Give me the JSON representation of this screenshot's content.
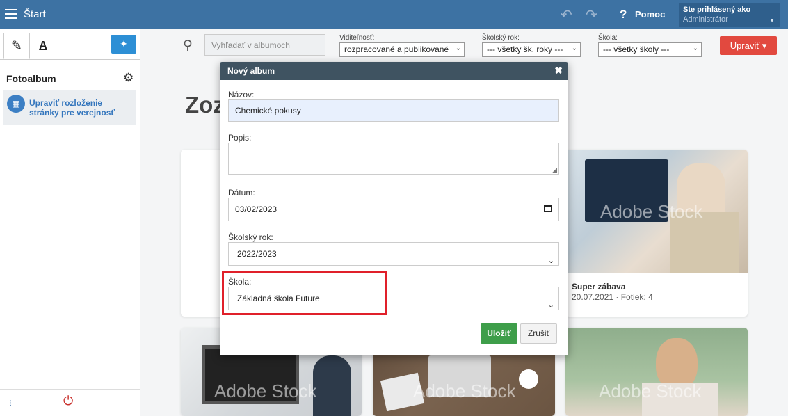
{
  "topbar": {
    "title": "Štart",
    "help_label": "Pomoc",
    "user_line1": "Ste prihlásený ako",
    "user_line2": "Administrátor",
    "bg_color": "#3d72a3"
  },
  "sidebar": {
    "heading": "Fotoalbum",
    "item_label": "Upraviť rozloženie stránky pre verejnosť"
  },
  "filters": {
    "search_placeholder": "Vyhľadať v albumoch",
    "visibility_label": "Viditeľnosť:",
    "visibility_value": "rozpracované a publikované",
    "year_label": "Školský rok:",
    "year_value": "--- všetky šk. roky ---",
    "school_label": "Škola:",
    "school_value": "--- všetky školy ---",
    "edit_label": "Upraviť"
  },
  "main": {
    "title_fragment": "Zoz"
  },
  "cards": [
    {
      "title": "Super zábava",
      "meta": "20.07.2021 · Fotiek: 4"
    }
  ],
  "watermark": "Adobe Stock",
  "modal": {
    "title": "Nový album",
    "name_label": "Názov:",
    "name_value": "Chemické pokusy",
    "desc_label": "Popis:",
    "date_label": "Dátum:",
    "date_value": "03/02/2023",
    "year_label": "Školský rok:",
    "year_value": "2022/2023",
    "school_label": "Škola:",
    "school_value": "Základná škola Future",
    "save_label": "Uložiť",
    "cancel_label": "Zrušiť"
  },
  "colors": {
    "accent_red": "#e2493f",
    "save_green": "#3e9e4a",
    "highlight": "#e0202a"
  }
}
